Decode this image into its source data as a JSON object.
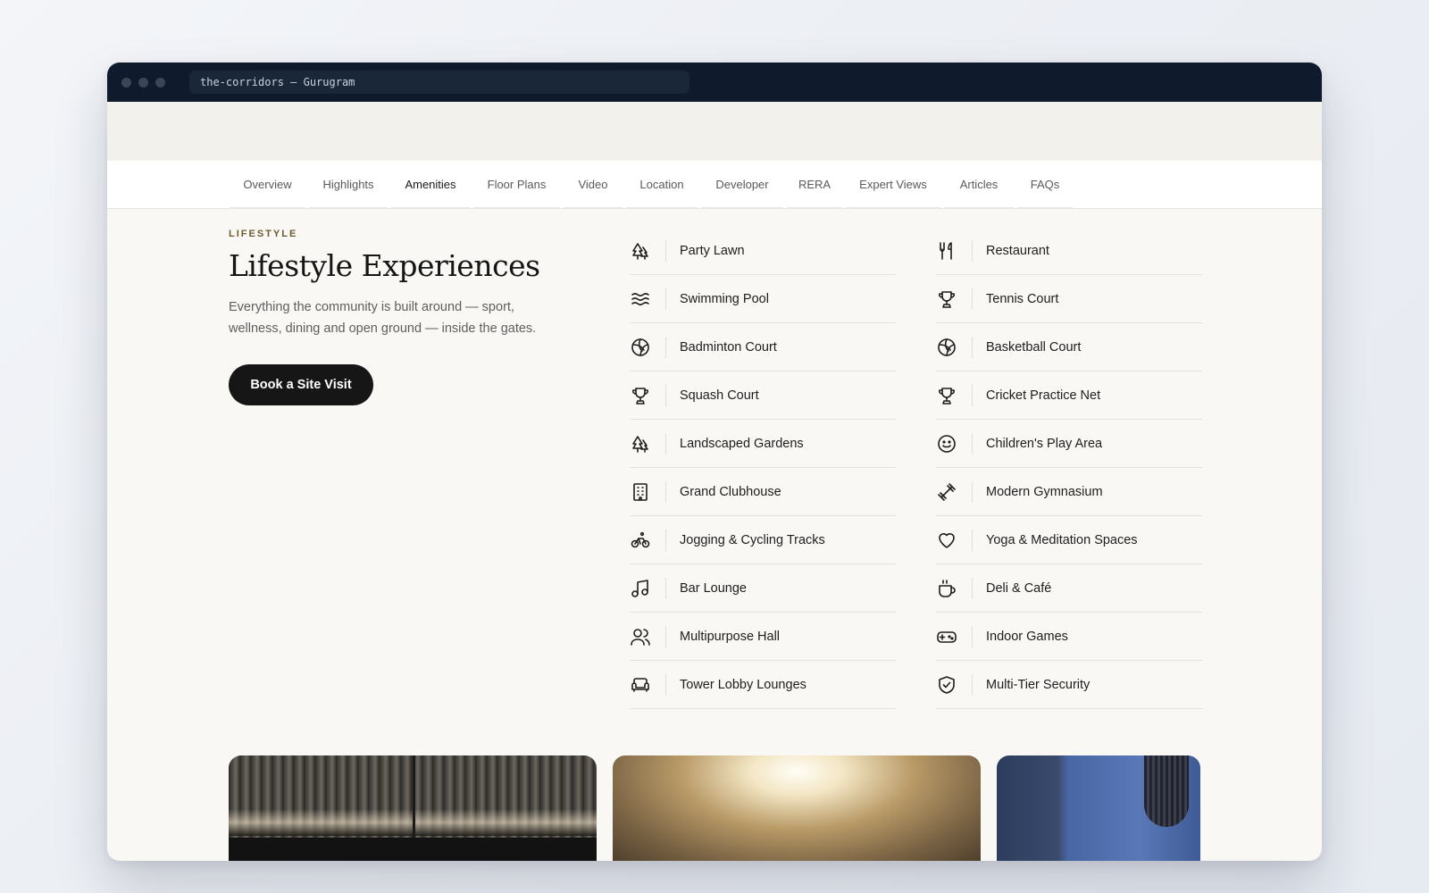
{
  "browser": {
    "url_text": "the-corridors — Gurugram"
  },
  "nav": {
    "tabs": [
      "Overview",
      "Highlights",
      "Amenities",
      "Floor Plans",
      "Video",
      "Location",
      "Developer",
      "RERA",
      "Expert Views",
      "Articles",
      "FAQs"
    ],
    "active_tab": "Amenities"
  },
  "intro": {
    "eyebrow": "LIFESTYLE",
    "title": "Lifestyle Experiences",
    "description": "Everything the community is built around — sport, wellness, dining and open ground — inside the gates.",
    "cta_label": "Book a Site Visit"
  },
  "amenities_left": [
    {
      "label": "Party Lawn",
      "icon": "trees-icon"
    },
    {
      "label": "Swimming Pool",
      "icon": "waves-icon"
    },
    {
      "label": "Badminton Court",
      "icon": "ball-icon"
    },
    {
      "label": "Squash Court",
      "icon": "trophy-icon"
    },
    {
      "label": "Landscaped Gardens",
      "icon": "trees-icon"
    },
    {
      "label": "Grand Clubhouse",
      "icon": "building-icon"
    },
    {
      "label": "Jogging & Cycling Tracks",
      "icon": "bike-icon"
    },
    {
      "label": "Bar Lounge",
      "icon": "music-icon"
    },
    {
      "label": "Multipurpose Hall",
      "icon": "users-icon"
    },
    {
      "label": "Tower Lobby Lounges",
      "icon": "sofa-icon"
    }
  ],
  "amenities_right": [
    {
      "label": "Restaurant",
      "icon": "utensils-icon"
    },
    {
      "label": "Tennis Court",
      "icon": "trophy-icon"
    },
    {
      "label": "Basketball Court",
      "icon": "ball-icon"
    },
    {
      "label": "Cricket Practice Net",
      "icon": "trophy-icon"
    },
    {
      "label": "Children's Play Area",
      "icon": "smile-icon"
    },
    {
      "label": "Modern Gymnasium",
      "icon": "dumbbell-icon"
    },
    {
      "label": "Yoga & Meditation Spaces",
      "icon": "heart-icon"
    },
    {
      "label": "Deli & Café",
      "icon": "coffee-icon"
    },
    {
      "label": "Indoor Games",
      "icon": "gamepad-icon"
    },
    {
      "label": "Multi-Tier Security",
      "icon": "shield-icon"
    }
  ]
}
